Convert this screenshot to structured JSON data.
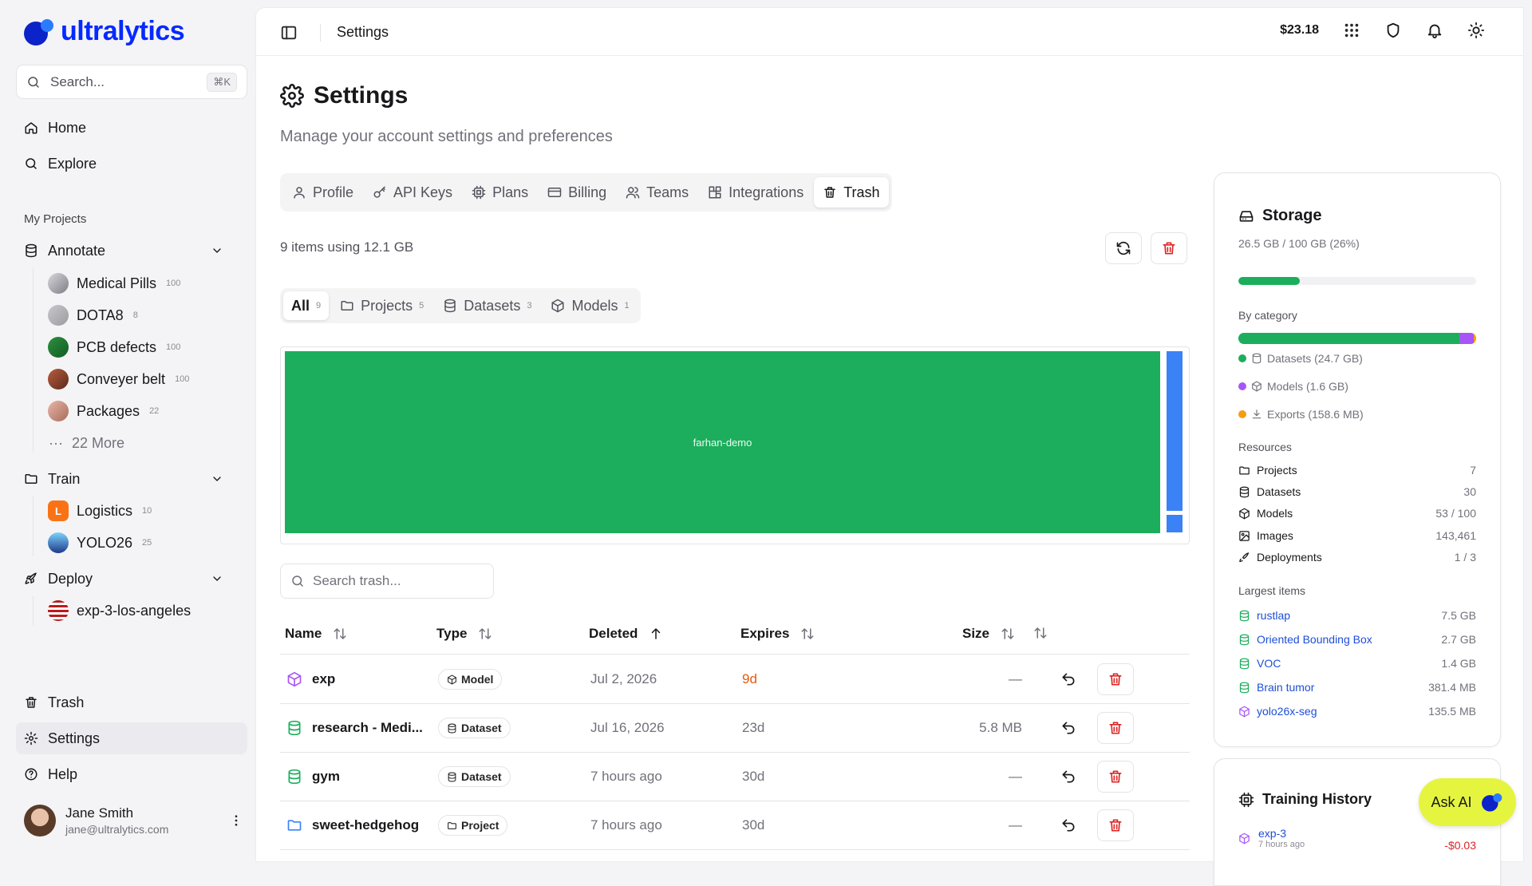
{
  "brand": {
    "name": "ultralytics"
  },
  "sidebar": {
    "search_placeholder": "Search...",
    "search_shortcut": "⌘K",
    "nav": {
      "home": "Home",
      "explore": "Explore"
    },
    "my_projects_label": "My Projects",
    "annotate": {
      "label": "Annotate",
      "items": [
        {
          "label": "Medical Pills",
          "count": "100"
        },
        {
          "label": "DOTA8",
          "count": "8"
        },
        {
          "label": "PCB defects",
          "count": "100"
        },
        {
          "label": "Conveyer belt",
          "count": "100"
        },
        {
          "label": "Packages",
          "count": "22"
        }
      ],
      "more": "22 More"
    },
    "train": {
      "label": "Train",
      "items": [
        {
          "label": "Logistics",
          "count": "10",
          "initial": "L"
        },
        {
          "label": "YOLO26",
          "count": "25"
        }
      ]
    },
    "deploy": {
      "label": "Deploy",
      "items": [
        {
          "label": "exp-3-los-angeles"
        }
      ]
    },
    "bottom": {
      "trash": "Trash",
      "settings": "Settings",
      "help": "Help"
    },
    "user": {
      "name": "Jane Smith",
      "email": "jane@ultralytics.com"
    }
  },
  "topbar": {
    "title": "Settings",
    "credit": "$23.18"
  },
  "page": {
    "title": "Settings",
    "subtitle": "Manage your account settings and preferences",
    "tabs": [
      "Profile",
      "API Keys",
      "Plans",
      "Billing",
      "Teams",
      "Integrations",
      "Trash"
    ],
    "active_tab": "Trash"
  },
  "trash": {
    "usage": "9 items using 12.1 GB",
    "filters": [
      {
        "label": "All",
        "count": "9"
      },
      {
        "label": "Projects",
        "count": "5"
      },
      {
        "label": "Datasets",
        "count": "3"
      },
      {
        "label": "Models",
        "count": "1"
      }
    ],
    "treemap_label": "farhan-demo",
    "search_placeholder": "Search trash...",
    "columns": {
      "name": "Name",
      "type": "Type",
      "deleted": "Deleted",
      "expires": "Expires",
      "size": "Size"
    },
    "rows": [
      {
        "name": "exp",
        "type": "Model",
        "deleted": "Jul 2, 2026",
        "expires": "9d",
        "size": "—"
      },
      {
        "name": "research - Medi...",
        "type": "Dataset",
        "deleted": "Jul 16, 2026",
        "expires": "23d",
        "size": "5.8 MB"
      },
      {
        "name": "gym",
        "type": "Dataset",
        "deleted": "7 hours ago",
        "expires": "30d",
        "size": "—"
      },
      {
        "name": "sweet-hedgehog",
        "type": "Project",
        "deleted": "7 hours ago",
        "expires": "30d",
        "size": "—"
      }
    ]
  },
  "storage": {
    "title": "Storage",
    "usage": "26.5 GB / 100 GB (26%)",
    "usage_fraction": 0.26,
    "by_category_label": "By category",
    "categories": [
      {
        "label": "Datasets (24.7 GB)",
        "color": "#1cae5c",
        "fraction": 0.93
      },
      {
        "label": "Models (1.6 GB)",
        "color": "#a855f7",
        "fraction": 0.06
      },
      {
        "label": "Exports (158.6 MB)",
        "color": "#f59e0b",
        "fraction": 0.01
      }
    ],
    "resources_label": "Resources",
    "resources": [
      {
        "label": "Projects",
        "value": "7"
      },
      {
        "label": "Datasets",
        "value": "30"
      },
      {
        "label": "Models",
        "value": "53 / 100"
      },
      {
        "label": "Images",
        "value": "143,461"
      },
      {
        "label": "Deployments",
        "value": "1 / 3"
      }
    ],
    "largest_label": "Largest items",
    "largest": [
      {
        "label": "rustlap",
        "value": "7.5 GB"
      },
      {
        "label": "Oriented Bounding Box",
        "value": "2.7 GB"
      },
      {
        "label": "VOC",
        "value": "1.4 GB"
      },
      {
        "label": "Brain tumor",
        "value": "381.4 MB"
      },
      {
        "label": "yolo26x-seg",
        "value": "135.5 MB"
      }
    ]
  },
  "training_history": {
    "title": "Training History",
    "items": [
      {
        "name": "exp-3",
        "time": "7 hours ago",
        "cost": "-$0.03"
      }
    ]
  },
  "ask_ai": "Ask AI"
}
